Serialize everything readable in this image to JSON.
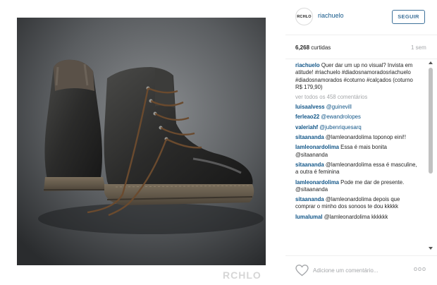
{
  "header": {
    "avatar_text": "RCHLO",
    "username": "riachuelo",
    "follow_label": "SEGUIR"
  },
  "stats": {
    "likes_count": "6,268",
    "likes_label": "curtidas",
    "time_ago": "1 sem"
  },
  "caption": {
    "user": "riachuelo",
    "text": "Quer dar um up no visual? Invista em atitude! #riachuelo #diadosnamoradosriachuelo #diadosnamorados #coturno #calçados (coturno R$ 179,90)"
  },
  "view_all": "ver todos os 458 comentários",
  "comments": [
    {
      "user": "luisaalvess",
      "text": "@guinevill"
    },
    {
      "user": "ferleao22",
      "text": "@ewandrolopes"
    },
    {
      "user": "valeriahf",
      "text": "@jubenriquesarq"
    },
    {
      "user": "sitaananda",
      "text": "@lamleonardolima toponop eini!!"
    },
    {
      "user": "lamleonardolima",
      "text": "Essa é mais bonita @sitaananda"
    },
    {
      "user": "sitaananda",
      "text": "@lamleonardolima essa é masculine, a outra é feminina"
    },
    {
      "user": "lamleonardolima",
      "text": "Pode me dar de presente. @sitaananda"
    },
    {
      "user": "sitaananda",
      "text": "@lamleonardolima depois que comprar o minho dos sonoos te dou kkkkk"
    },
    {
      "user": "lumalumal",
      "text": "@lamleonardolima kkkkkk"
    }
  ],
  "footer": {
    "comment_placeholder": "Adicione um comentário...",
    "more_label": "ooo"
  },
  "watermark": "RCHLO",
  "colors": {
    "link": "#125688",
    "follow_border": "#3f729b",
    "muted": "#a5a7aa"
  }
}
